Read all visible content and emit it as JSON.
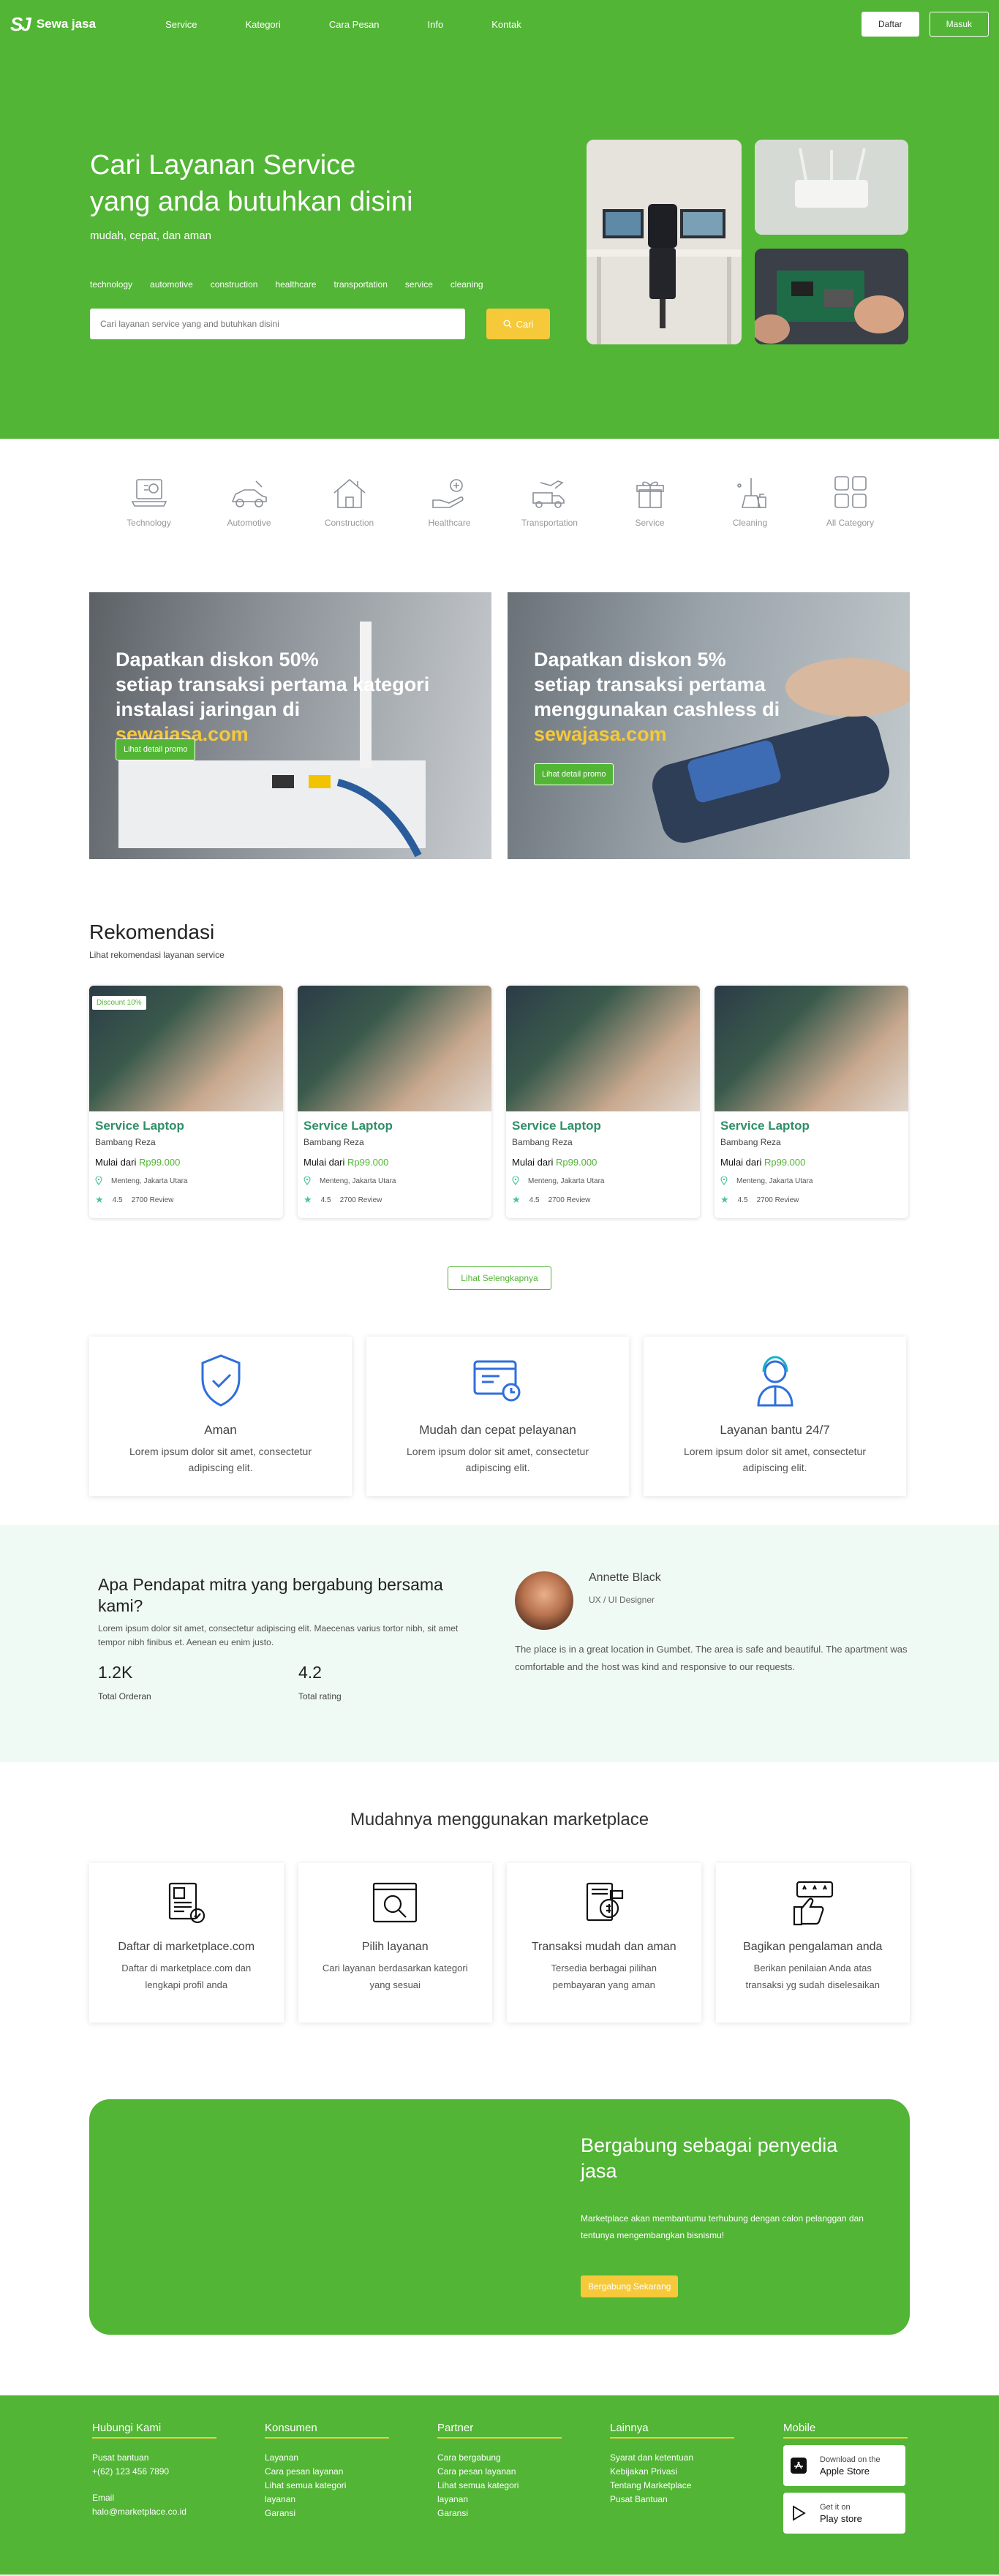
{
  "nav": {
    "brand": "Sewa jasa",
    "logo_mark": "SJ",
    "menu": [
      "Service",
      "Kategori",
      "Cara Pesan",
      "Info",
      "Kontak"
    ],
    "daftar": "Daftar",
    "masuk": "Masuk"
  },
  "hero": {
    "title_line1": "Cari Layanan Service",
    "title_line2": "yang anda butuhkan disini",
    "subtitle": "mudah, cepat, dan aman",
    "tags": [
      "technology",
      "automotive",
      "construction",
      "healthcare",
      "transportation",
      "service",
      "cleaning"
    ],
    "search_placeholder": "Cari layanan service yang and butuhkan disini",
    "search_button": "Cari"
  },
  "categories": [
    {
      "label": "Technology",
      "icon": "laptop-icon"
    },
    {
      "label": "Automotive",
      "icon": "car-icon"
    },
    {
      "label": "Construction",
      "icon": "house-icon"
    },
    {
      "label": "Healthcare",
      "icon": "health-hand-icon"
    },
    {
      "label": "Transportation",
      "icon": "truck-icon"
    },
    {
      "label": "Service",
      "icon": "gift-icon"
    },
    {
      "label": "Cleaning",
      "icon": "cleaning-icon"
    },
    {
      "label": "All Category",
      "icon": "grid-icon"
    }
  ],
  "promos": [
    {
      "line1": "Dapatkan diskon 50%",
      "line2": "setiap transaksi pertama kategori",
      "line3": "instalasi jaringan di ",
      "highlight": "sewajasa.com",
      "button": "Lihat detail promo"
    },
    {
      "line1": "Dapatkan diskon 5%",
      "line2": "setiap transaksi pertama",
      "line3": "menggunakan cashless di",
      "highlight": "sewajasa.com",
      "button": "Lihat detail promo"
    }
  ],
  "recommendation": {
    "title": "Rekomendasi",
    "subtitle": "Lihat rekomendasi layanan service",
    "badge": "Discount 10%",
    "cards": [
      {
        "title": "Service Laptop",
        "author": "Bambang Reza",
        "price_label": "Mulai dari ",
        "price": "Rp99.000",
        "location": "Menteng, Jakarta Utara",
        "rating": "4.5",
        "reviews": "2700 Review"
      },
      {
        "title": "Service Laptop",
        "author": "Bambang Reza",
        "price_label": "Mulai dari ",
        "price": "Rp99.000",
        "location": "Menteng, Jakarta Utara",
        "rating": "4.5",
        "reviews": "2700 Review"
      },
      {
        "title": "Service Laptop",
        "author": "Bambang Reza",
        "price_label": "Mulai dari ",
        "price": "Rp99.000",
        "location": "Menteng, Jakarta Utara",
        "rating": "4.5",
        "reviews": "2700 Review"
      },
      {
        "title": "Service Laptop",
        "author": "Bambang Reza",
        "price_label": "Mulai dari ",
        "price": "Rp99.000",
        "location": "Menteng, Jakarta Utara",
        "rating": "4.5",
        "reviews": "2700 Review"
      }
    ],
    "more_button": "Lihat Selengkapnya"
  },
  "features": [
    {
      "title": "Aman",
      "desc": "Lorem ipsum dolor sit amet, consectetur adipiscing elit."
    },
    {
      "title": "Mudah dan cepat pelayanan",
      "desc": "Lorem ipsum dolor sit amet, consectetur adipiscing elit."
    },
    {
      "title": "Layanan bantu 24/7",
      "desc": "Lorem ipsum dolor sit amet, consectetur adipiscing elit."
    }
  ],
  "testimonial": {
    "question": "Apa Pendapat mitra yang bergabung bersama kami?",
    "desc": "Lorem ipsum dolor sit amet, consectetur adipiscing elit. Maecenas varius tortor nibh, sit amet tempor nibh finibus et. Aenean eu enim justo.",
    "stat1_value": "1.2K",
    "stat1_label": "Total Orderan",
    "stat2_value": "4.2",
    "stat2_label": "Total rating",
    "name": "Annette Black",
    "role": "UX / UI Designer",
    "text": "The place is in a great location in Gumbet. The area is safe and beautiful. The apartment was comfortable and the host was kind and responsive to our requests."
  },
  "how": {
    "title": "Mudahnya menggunakan marketplace",
    "steps": [
      {
        "title": "Daftar di marketplace.com",
        "desc": "Daftar di marketplace.com dan lengkapi profil anda"
      },
      {
        "title": "Pilih layanan",
        "desc": "Cari layanan berdasarkan kategori yang sesuai"
      },
      {
        "title": "Transaksi mudah dan aman",
        "desc": "Tersedia berbagai pilihan pembayaran yang aman"
      },
      {
        "title": "Bagikan pengalaman anda",
        "desc": "Berikan penilaian Anda atas transaksi yg sudah diselesaikan"
      }
    ]
  },
  "join": {
    "title": "Bergabung sebagai penyedia jasa",
    "desc": "Marketplace akan membantumu terhubung dengan calon pelanggan dan tentunya mengembangkan bisnismu!",
    "button": "Bergabung Sekarang"
  },
  "footer": {
    "contact_title": "Hubungi Kami",
    "contact_help": "Pusat bantuan",
    "contact_phone": "+(62) 123 456 7890",
    "contact_email_label": "Email",
    "contact_email": "halo@marketplace.co.id",
    "konsumen_title": "Konsumen",
    "konsumen_links": [
      "Layanan",
      "Cara pesan layanan",
      "Lihat semua kategori layanan",
      "Garansi"
    ],
    "partner_title": "Partner",
    "partner_links": [
      "Cara bergabung",
      "Cara pesan layanan",
      "Lihat semua kategori layanan",
      "Garansi"
    ],
    "lainnya_title": "Lainnya",
    "lainnya_links": [
      "Syarat dan ketentuan",
      "Kebijakan Privasi",
      "Tentang Marketplace",
      "Pusat Bantuan"
    ],
    "mobile_title": "Mobile",
    "apple_small": "Download on the",
    "apple_big": "Apple Store",
    "play_small": "Get it on",
    "play_big": "Play store"
  }
}
